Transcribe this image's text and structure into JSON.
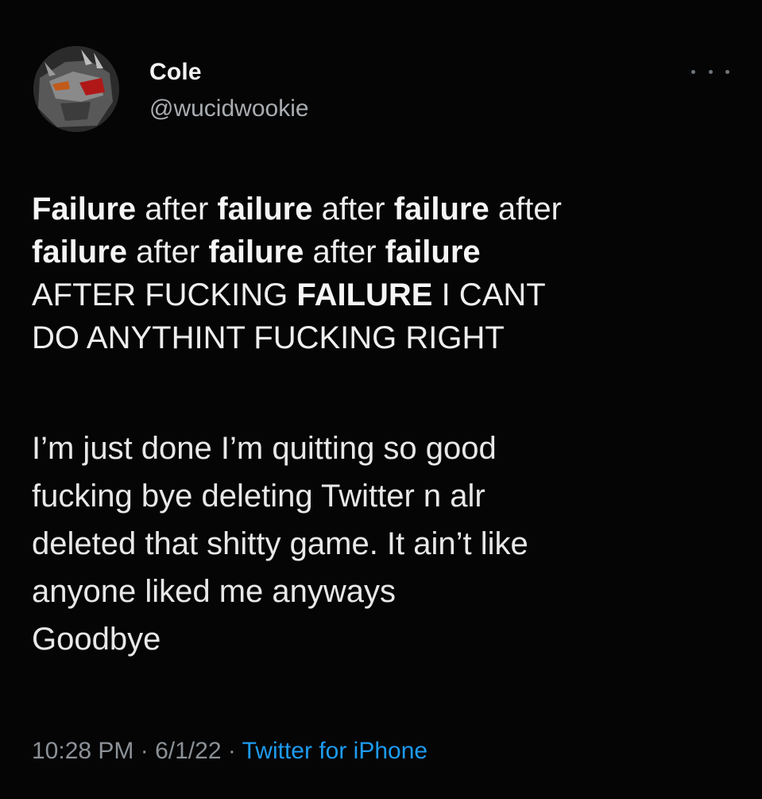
{
  "author": {
    "display_name": "Cole",
    "handle": "@wucidwookie",
    "avatar_icon": "avatar-anime-mask"
  },
  "more_icon": "more-dots-icon",
  "body": {
    "paragraph1": [
      [
        {
          "t": "Failure",
          "b": true
        },
        {
          "t": " after ",
          "b": false
        },
        {
          "t": "failure",
          "b": true
        },
        {
          "t": " after ",
          "b": false
        },
        {
          "t": "failure",
          "b": true
        },
        {
          "t": " after",
          "b": false
        }
      ],
      [
        {
          "t": "failure",
          "b": true
        },
        {
          "t": " after ",
          "b": false
        },
        {
          "t": "failure",
          "b": true
        },
        {
          "t": " after ",
          "b": false
        },
        {
          "t": "failure",
          "b": true
        }
      ],
      [
        {
          "t": "AFTER FUCKING ",
          "b": false
        },
        {
          "t": "FAILURE",
          "b": true
        },
        {
          "t": " I CANT",
          "b": false
        }
      ],
      [
        {
          "t": "DO ANYTHINT FUCKING RIGHT",
          "b": false
        }
      ]
    ],
    "paragraph2": [
      "I’m just done I’m quitting so good",
      "fucking bye deleting Twitter n alr",
      "deleted that shitty game. It ain’t like",
      "anyone liked me anyways",
      "Goodbye"
    ]
  },
  "meta": {
    "time": "10:28 PM",
    "separator": " · ",
    "date": "6/1/22",
    "source": "Twitter for iPhone"
  },
  "colors": {
    "background": "#050505",
    "text": "#e7e9ea",
    "secondary": "#8b9197",
    "link": "#1d9bf0"
  }
}
